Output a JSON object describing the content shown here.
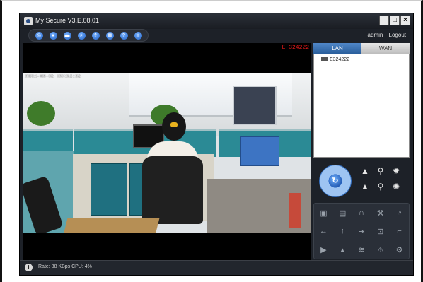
{
  "window": {
    "title": "My Secure  V3.E.08.01",
    "minimize": "_",
    "maximize": "□",
    "close": "×"
  },
  "toolbar": {
    "buttons": [
      "◎",
      "●",
      "▬",
      "⌕",
      "⇡",
      "▦",
      "?",
      "i"
    ]
  },
  "user": {
    "name": "admin",
    "logout": "Logout"
  },
  "video": {
    "device_label": "E 324222",
    "timestamp": "2024-08-04 09:34:34"
  },
  "tabs": {
    "lan": "LAN",
    "wan": "WAN"
  },
  "devices": [
    {
      "name": "E324222"
    }
  ],
  "statusbar": {
    "text": "Rate: 88 KBps  CPU:   4%"
  },
  "colors": {
    "app_bg": "#1d2128",
    "accent": "#2a5f9c",
    "osd_red": "#e01818"
  }
}
